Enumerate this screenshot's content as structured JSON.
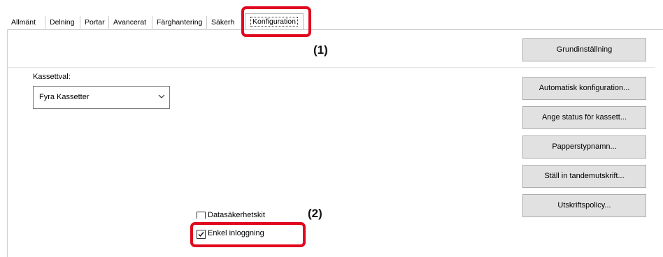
{
  "tabs": [
    {
      "label": "Allmänt"
    },
    {
      "label": "Delning"
    },
    {
      "label": "Portar"
    },
    {
      "label": "Avancerat"
    },
    {
      "label": "Färghantering"
    },
    {
      "label": "Säkerh"
    },
    {
      "label": "Konfiguration"
    }
  ],
  "callouts": {
    "one": "(1)",
    "two": "(2)"
  },
  "tray": {
    "label": "Kassettval:",
    "selected": "Fyra Kassetter"
  },
  "buttons": {
    "basic": "Grundinställning",
    "auto_config": "Automatisk konfiguration...",
    "tray_status": "Ange status för kassett...",
    "paper_type_name": "Papperstypnamn...",
    "tandem": "Ställ in tandemutskrift...",
    "print_policy": "Utskriftspolicy..."
  },
  "checkboxes": {
    "data_security": {
      "label": "Datasäkerhetskit",
      "checked": false
    },
    "single_sign_on": {
      "label": "Enkel inloggning",
      "checked": true
    }
  },
  "colors": {
    "highlight": "#e1071e",
    "button_bg": "#e1e1e1"
  }
}
